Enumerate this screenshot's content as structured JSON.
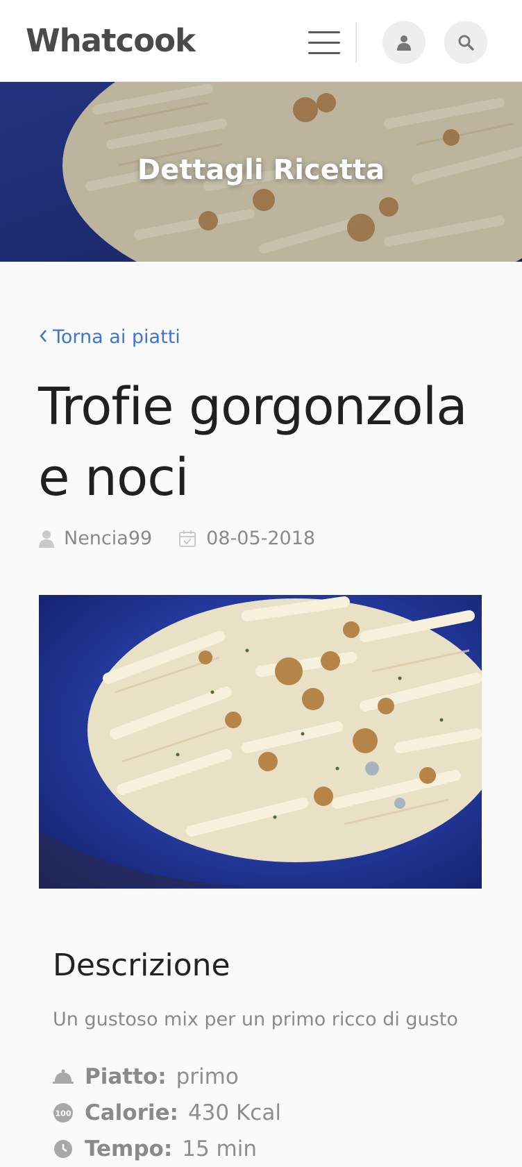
{
  "header": {
    "brand": "Whatcook",
    "menu_icon": "hamburger-menu-icon",
    "user_icon": "user-icon",
    "search_icon": "search-icon"
  },
  "hero": {
    "title": "Dettagli Ricetta"
  },
  "back_link": {
    "icon": "chevron-left-icon",
    "label": "Torna ai piatti"
  },
  "recipe": {
    "title": "Trofie gorgonzola e noci",
    "author": "Nencia99",
    "date": "08-05-2018",
    "description_heading": "Descrizione",
    "description": "Un gustoso mix per un primo ricco di gusto",
    "properties": [
      {
        "icon": "cloche-icon",
        "label": "Piatto:",
        "value": "primo"
      },
      {
        "icon": "calories-100-icon",
        "label": "Calorie:",
        "value": "430 Kcal"
      },
      {
        "icon": "clock-icon",
        "label": "Tempo:",
        "value": "15 min"
      }
    ]
  },
  "colors": {
    "link": "#3f74d1",
    "text": "#202020",
    "muted": "#8a8a8a",
    "plate": "#243a9e"
  }
}
